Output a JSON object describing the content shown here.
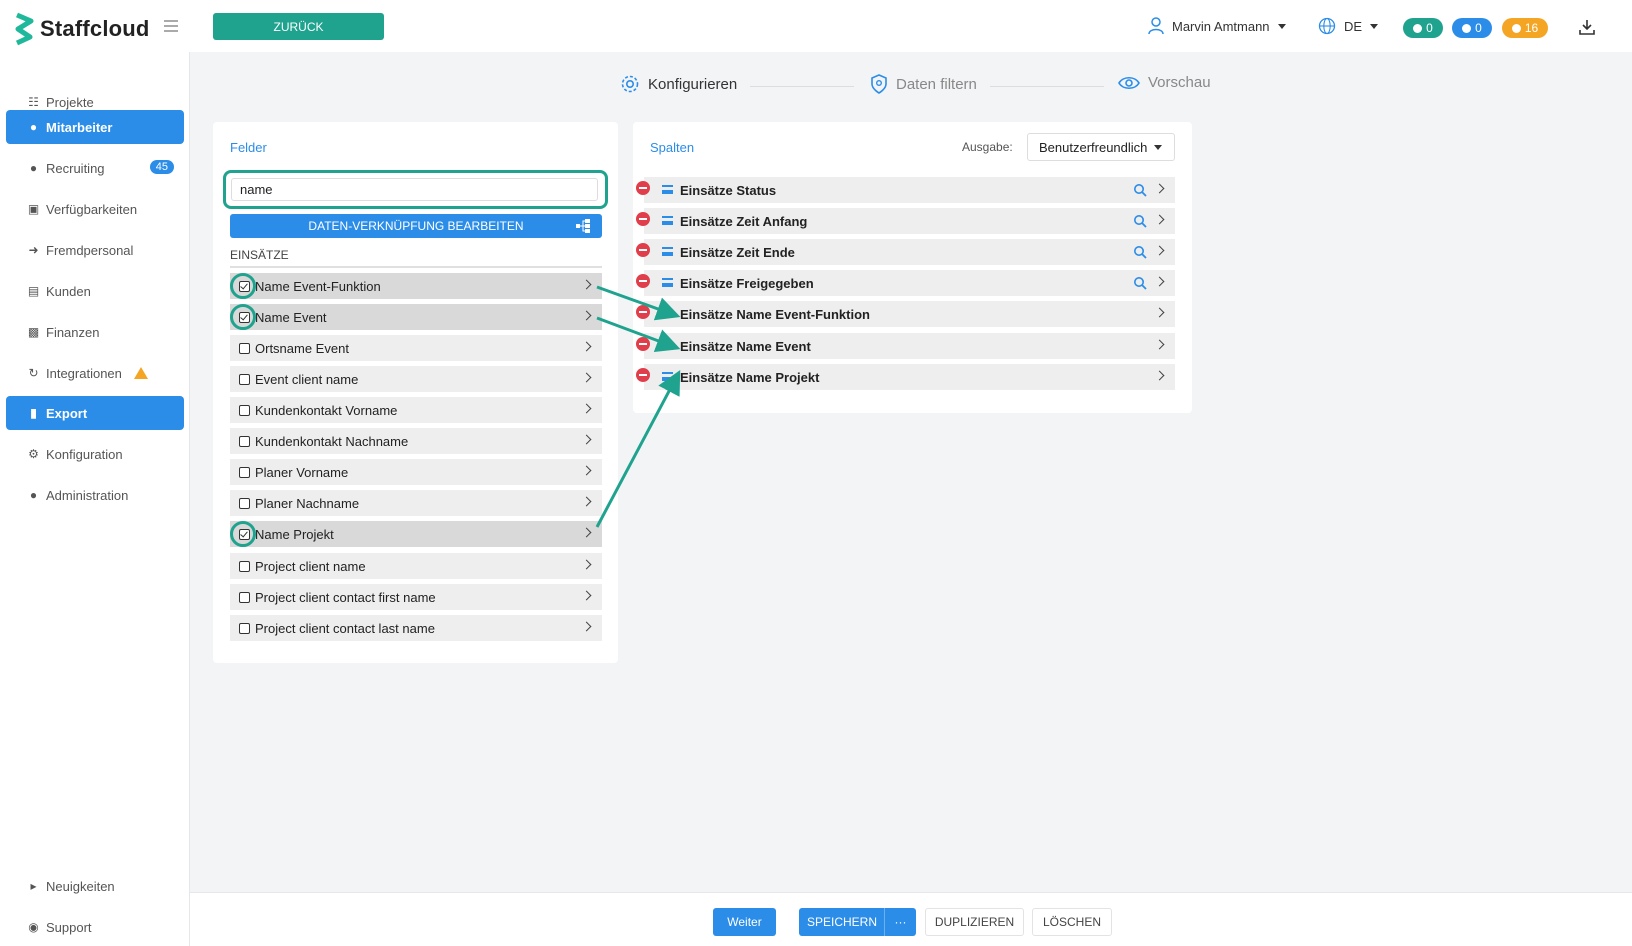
{
  "app": {
    "name": "Staffcloud"
  },
  "topbar": {
    "back_label": "ZURÜCK",
    "user_name": "Marvin Amtmann",
    "language": "DE",
    "messages_count": "0",
    "notifications_count": "0",
    "alerts_count": "16"
  },
  "sidebar": {
    "items": [
      {
        "label": "Projekte",
        "icon": "sitemap-icon"
      },
      {
        "label": "Mitarbeiter",
        "icon": "users-icon",
        "active": true
      },
      {
        "label": "Recruiting",
        "icon": "user-plus-icon",
        "badge": "45"
      },
      {
        "label": "Verfügbarkeiten",
        "icon": "calendar-check-icon"
      },
      {
        "label": "Fremdpersonal",
        "icon": "sign-in-icon"
      },
      {
        "label": "Kunden",
        "icon": "building-icon"
      },
      {
        "label": "Finanzen",
        "icon": "money-icon"
      },
      {
        "label": "Integrationen",
        "icon": "sync-icon",
        "warning": true
      },
      {
        "label": "Export",
        "icon": "file-icon",
        "active": true
      },
      {
        "label": "Konfiguration",
        "icon": "gear-icon"
      },
      {
        "label": "Administration",
        "icon": "user-cog-icon"
      }
    ],
    "bottom": [
      {
        "label": "Neuigkeiten",
        "icon": "megaphone-icon"
      },
      {
        "label": "Support",
        "icon": "comments-icon"
      }
    ]
  },
  "stepper": {
    "steps": [
      {
        "label": "Konfigurieren",
        "state": "active"
      },
      {
        "label": "Daten filtern",
        "state": "inactive"
      },
      {
        "label": "Vorschau",
        "state": "inactive"
      }
    ]
  },
  "fields_panel": {
    "title": "Felder",
    "search_value": "name",
    "link_button_label": "DATEN-VERKNÜPFUNG BEARBEITEN",
    "section_title": "EINSÄTZE",
    "items": [
      {
        "label": "Name Event-Funktion",
        "checked": true
      },
      {
        "label": "Name Event",
        "checked": true
      },
      {
        "label": "Ortsname Event",
        "checked": false
      },
      {
        "label": "Event client name",
        "checked": false
      },
      {
        "label": "Kundenkontakt Vorname",
        "checked": false
      },
      {
        "label": "Kundenkontakt Nachname",
        "checked": false
      },
      {
        "label": "Planer Vorname",
        "checked": false
      },
      {
        "label": "Planer Nachname",
        "checked": false
      },
      {
        "label": "Name Projekt",
        "checked": true
      },
      {
        "label": "Project client name",
        "checked": false
      },
      {
        "label": "Project client contact first name",
        "checked": false
      },
      {
        "label": "Project client contact last name",
        "checked": false
      }
    ]
  },
  "columns_panel": {
    "title": "Spalten",
    "output_label": "Ausgabe:",
    "output_value": "Benutzerfreundlich",
    "items": [
      {
        "label": "Einsätze Status",
        "searchable": true
      },
      {
        "label": "Einsätze Zeit Anfang",
        "searchable": true
      },
      {
        "label": "Einsätze Zeit Ende",
        "searchable": true
      },
      {
        "label": "Einsätze Freigegeben",
        "searchable": true
      },
      {
        "label": "Einsätze Name Event-Funktion",
        "searchable": false
      },
      {
        "label": "Einsätze Name Event",
        "searchable": false
      },
      {
        "label": "Einsätze Name Projekt",
        "searchable": false
      }
    ]
  },
  "footer": {
    "next_label": "Weiter",
    "save_label": "SPEICHERN",
    "more_label": "···",
    "duplicate_label": "DUPLIZIEREN",
    "delete_label": "LÖSCHEN"
  },
  "colors": {
    "primary": "#2b8de8",
    "teal": "#1fa38f",
    "danger": "#e03e4a",
    "warning": "#f5a524"
  }
}
